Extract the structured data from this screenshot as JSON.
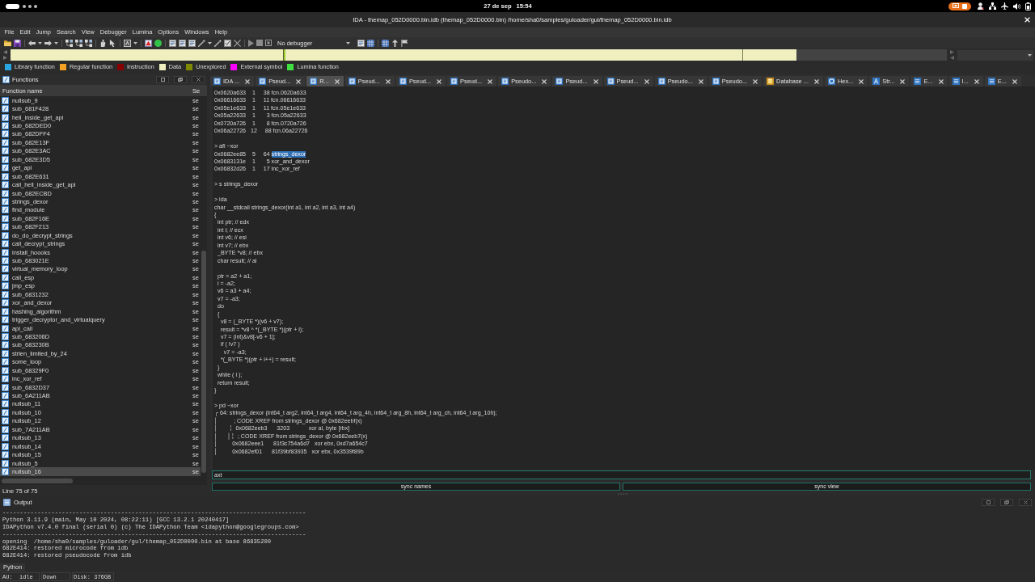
{
  "system_bar": {
    "date": "27 de sep",
    "time": "15:54"
  },
  "window": {
    "title": "IDA - themap_052D0000.bin.idb (themap_052D0000.bin) /home/sha0/samples/guloader/gul/themap_052D0000.bin.idb"
  },
  "menu": [
    "File",
    "Edit",
    "Jump",
    "Search",
    "View",
    "Debugger",
    "Lumina",
    "Options",
    "Windows",
    "Help"
  ],
  "toolbar": {
    "debugger": "No debugger"
  },
  "legend": [
    {
      "label": "Library function",
      "color": "#29a6e2"
    },
    {
      "label": "Regular function",
      "color": "#f2a124"
    },
    {
      "label": "Instruction",
      "color": "#870000"
    },
    {
      "label": "Data",
      "color": "#efefbf"
    },
    {
      "label": "Unexplored",
      "color": "#7f8a00"
    },
    {
      "label": "External symbol",
      "color": "#ff00ff"
    },
    {
      "label": "Lumina function",
      "color": "#3fe03f"
    }
  ],
  "functions": {
    "title": "Functions",
    "columns": [
      "Function name",
      "Se"
    ],
    "rows": [
      {
        "name": "nullsub_9",
        "segment": "se",
        "selected": false
      },
      {
        "name": "sub_681F428",
        "segment": "se",
        "selected": false
      },
      {
        "name": "hell_inside_get_api",
        "segment": "se",
        "selected": false
      },
      {
        "name": "sub_682DED0",
        "segment": "se",
        "selected": false
      },
      {
        "name": "sub_682DFF4",
        "segment": "se",
        "selected": false
      },
      {
        "name": "sub_682E13F",
        "segment": "se",
        "selected": false
      },
      {
        "name": "sub_682E3AC",
        "segment": "se",
        "selected": false
      },
      {
        "name": "sub_682E3D5",
        "segment": "se",
        "selected": false
      },
      {
        "name": "get_api",
        "segment": "se",
        "selected": false
      },
      {
        "name": "sub_682E631",
        "segment": "se",
        "selected": false
      },
      {
        "name": "call_hell_inside_get_api",
        "segment": "se",
        "selected": false
      },
      {
        "name": "sub_682ECBD",
        "segment": "se",
        "selected": false
      },
      {
        "name": "strings_dexor",
        "segment": "se",
        "selected": false
      },
      {
        "name": "find_module",
        "segment": "se",
        "selected": false
      },
      {
        "name": "sub_682F16E",
        "segment": "se",
        "selected": false
      },
      {
        "name": "sub_682F213",
        "segment": "se",
        "selected": false
      },
      {
        "name": "do_do_decrypt_strings",
        "segment": "se",
        "selected": false
      },
      {
        "name": "call_decrypt_strings",
        "segment": "se",
        "selected": false
      },
      {
        "name": "install_hoooks",
        "segment": "se",
        "selected": false
      },
      {
        "name": "sub_683021E",
        "segment": "se",
        "selected": false
      },
      {
        "name": "virtual_memory_loop",
        "segment": "se",
        "selected": false
      },
      {
        "name": "call_esp",
        "segment": "se",
        "selected": false
      },
      {
        "name": "jmp_esp",
        "segment": "se",
        "selected": false
      },
      {
        "name": "sub_6831232",
        "segment": "se",
        "selected": false
      },
      {
        "name": "xor_and_dexor",
        "segment": "se",
        "selected": false
      },
      {
        "name": "hashing_algorithm",
        "segment": "se",
        "selected": false
      },
      {
        "name": "trigger_decryptor_and_virtualquery",
        "segment": "se",
        "selected": false
      },
      {
        "name": "api_call",
        "segment": "se",
        "selected": false
      },
      {
        "name": "sub_683206D",
        "segment": "se",
        "selected": false
      },
      {
        "name": "sub_683230B",
        "segment": "se",
        "selected": false
      },
      {
        "name": "strlen_limited_by_24",
        "segment": "se",
        "selected": false
      },
      {
        "name": "some_loop",
        "segment": "se",
        "selected": false
      },
      {
        "name": "sub_68329F0",
        "segment": "se",
        "selected": false
      },
      {
        "name": "inc_xor_ref",
        "segment": "se",
        "selected": false
      },
      {
        "name": "sub_6832D37",
        "segment": "se",
        "selected": false
      },
      {
        "name": "sub_6A211AB",
        "segment": "se",
        "selected": false
      },
      {
        "name": "nullsub_11",
        "segment": "se",
        "selected": false
      },
      {
        "name": "nullsub_10",
        "segment": "se",
        "selected": false
      },
      {
        "name": "nullsub_12",
        "segment": "se",
        "selected": false
      },
      {
        "name": "sub_7A211AB",
        "segment": "se",
        "selected": false
      },
      {
        "name": "nullsub_13",
        "segment": "se",
        "selected": false
      },
      {
        "name": "nullsub_14",
        "segment": "se",
        "selected": false
      },
      {
        "name": "nullsub_15",
        "segment": "se",
        "selected": false
      },
      {
        "name": "nullsub_5",
        "segment": "se",
        "selected": false
      },
      {
        "name": "nullsub_16",
        "segment": "se",
        "selected": true
      }
    ],
    "status": "Line 75 of 75"
  },
  "tabs": [
    {
      "label": "IDA ...",
      "kind": "code",
      "selected": false
    },
    {
      "label": "Pseud...",
      "kind": "code",
      "selected": false
    },
    {
      "label": "R...",
      "kind": "code",
      "selected": true
    },
    {
      "label": "Pseud...",
      "kind": "code",
      "selected": false
    },
    {
      "label": "Pseud...",
      "kind": "code",
      "selected": false
    },
    {
      "label": "Pseud...",
      "kind": "code",
      "selected": false
    },
    {
      "label": "Pseudo...",
      "kind": "code",
      "selected": false
    },
    {
      "label": "Pseud...",
      "kind": "code",
      "selected": false
    },
    {
      "label": "Pseud...",
      "kind": "code",
      "selected": false
    },
    {
      "label": "Pseudo...",
      "kind": "code",
      "selected": false
    },
    {
      "label": "Pseudo...",
      "kind": "code",
      "selected": false
    },
    {
      "label": "Database ...",
      "kind": "database",
      "selected": false
    },
    {
      "label": "Hex...",
      "kind": "hex",
      "selected": false
    },
    {
      "label": "Str...",
      "kind": "strings",
      "selected": false
    },
    {
      "label": "E...",
      "kind": "list",
      "selected": false
    },
    {
      "label": "I...",
      "kind": "list",
      "selected": false
    },
    {
      "label": "E...",
      "kind": "list",
      "selected": false
    }
  ],
  "console": {
    "blocks": [
      {
        "lines": [
          {
            "text": "0x0620a633    1     38 fcn.0620a633"
          },
          {
            "text": "0x06616633    1     11 fcn.06616633"
          },
          {
            "text": "0x05e1e633    1     11 fcn.05e1e633"
          },
          {
            "text": "0x05a22633    1       3 fcn.05a22633"
          },
          {
            "text": "0x0720a726    1       8 fcn.0720a726"
          },
          {
            "text": "0x06a22726   12     88 fcn.06a22726"
          }
        ]
      },
      {
        "lines": [
          {
            "text": "> afl ~xor"
          },
          {
            "text": "0x0682ee85    5     64 ",
            "selected_text": "strings_dexor"
          },
          {
            "text": "0x0683131e    1       5 xor_and_dexor"
          },
          {
            "text": "0x06832d26    1     17 inc_xor_ref"
          }
        ]
      },
      {
        "lines": [
          {
            "text": "> s strings_dexor"
          }
        ]
      },
      {
        "lines": [
          {
            "text": "> ida"
          },
          {
            "text": "char __stdcall strings_dexor(int a1, int a2, int a3, int a4)"
          },
          {
            "text": "{"
          },
          {
            "text": "  int ptr; // edx"
          },
          {
            "text": "  int i; // ecx"
          },
          {
            "text": "  int v6; // esi"
          },
          {
            "text": "  int v7; // ebx"
          },
          {
            "text": "  _BYTE *v8; // ebx"
          },
          {
            "text": "  char result; // al"
          }
        ]
      },
      {
        "lines": [
          {
            "text": "  ptr = a2 + a1;"
          },
          {
            "text": "  i = -a2;"
          },
          {
            "text": "  v6 = a3 + a4;"
          },
          {
            "text": "  v7 = -a3;"
          },
          {
            "text": "  do"
          },
          {
            "text": "  {"
          },
          {
            "text": "    v8 = (_BYTE *)(v6 + v7);"
          },
          {
            "text": "    result = *v8 ^ *(_BYTE *)(ptr + i);"
          },
          {
            "text": "    v7 = (int)&v8[-v6 + 1];"
          },
          {
            "text": "    if ( !v7 )"
          },
          {
            "text": "      v7 = -a3;"
          },
          {
            "text": "    *(_BYTE *)(ptr + i++) = result;"
          },
          {
            "text": "  }"
          },
          {
            "text": "  while ( i );"
          },
          {
            "text": "  return result;"
          },
          {
            "text": "}"
          }
        ]
      },
      {
        "lines": [
          {
            "text": "> pd ~xor"
          },
          {
            "text": "┌ 64: strings_dexor (int64_t arg2, int64_t arg4, int64_t arg_4h, int64_t arg_8h, int64_t arg_ch, int64_t arg_10h);"
          },
          {
            "text": "│          ; CODE XREF from strings_dexor @ 0x682eebf(x)"
          },
          {
            "text": "│       ╎  0x0682eeb3      3203            xor al, byte [rbx]"
          },
          {
            "text": "│      │╎  ; CODE XREF from strings_dexor @ 0x682eeb7(x)"
          },
          {
            "text": "│         0x0682eee1      81f3c754a6d7   xor ebx, 0xd7a654c7"
          },
          {
            "text": "│         0x0682ef01      81f39bf83935   xor ebx, 0x3539f89b"
          }
        ]
      }
    ],
    "command": "axt",
    "buttons": [
      "sync names",
      "sync view"
    ]
  },
  "output": {
    "title": "Output",
    "lines": [
      "---------------------------------------------------------------------------------------",
      "Python 3.11.9 (main, May 10 2024, 08:22:11) [GCC 13.2.1 20240417]",
      "IDAPython v7.4.0 final (serial 0) (c) The IDAPython Team <idapython@googlegroups.com>",
      "---------------------------------------------------------------------------------------",
      "opening  /home/sha0/samples/guloader/gul/themap_052D0000.bin at base 86835200",
      "682E414: restored microcode from idb",
      "682E414: restored pseudocode from idb"
    ],
    "interpreter": "Python"
  },
  "status_bar": [
    "AU:  idle",
    "Down",
    "Disk: 376GB"
  ]
}
